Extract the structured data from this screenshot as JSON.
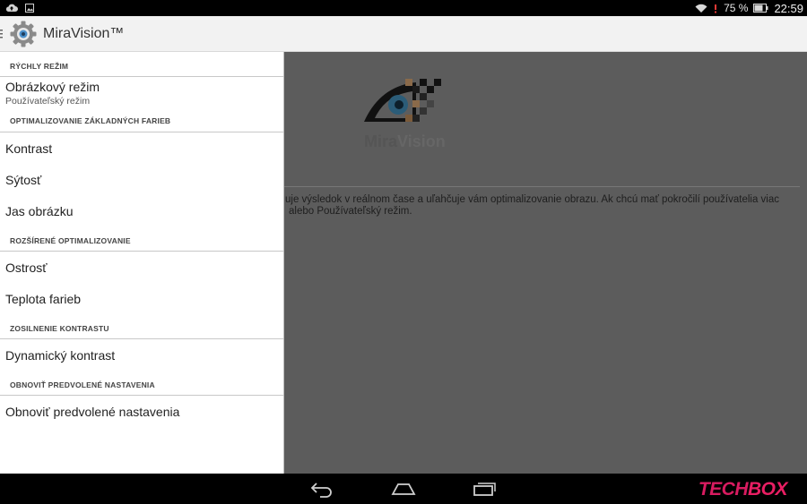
{
  "status_bar": {
    "battery_percent": "75 %",
    "clock": "22:59",
    "battery_level": 0.75
  },
  "action_bar": {
    "title": "MiraVision™"
  },
  "drawer": {
    "sections": [
      {
        "header": "RÝCHLY REŽIM",
        "items": [
          {
            "title": "Obrázkový režim",
            "subtitle": "Používateľský režim"
          }
        ]
      },
      {
        "header": "OPTIMALIZOVANIE ZÁKLADNÝCH FARIEB",
        "items": [
          {
            "title": "Kontrast"
          },
          {
            "title": "Sýtosť"
          },
          {
            "title": "Jas obrázku"
          }
        ]
      },
      {
        "header": "ROZŠÍRENÉ OPTIMALIZOVANIE",
        "items": [
          {
            "title": "Ostrosť"
          },
          {
            "title": "Teplota farieb"
          }
        ]
      },
      {
        "header": "ZOSILNENIE KONTRASTU",
        "items": [
          {
            "title": "Dynamický kontrast"
          }
        ]
      },
      {
        "header": "OBNOVIŤ PREDVOLENÉ NASTAVENIA",
        "items": [
          {
            "title": "Obnoviť predvolené nastavenia"
          }
        ]
      }
    ]
  },
  "content": {
    "logo_text_mira": "Mira",
    "logo_text_vision": "Vision",
    "description_line1": "uje výsledok v reálnom čase a uľahčuje vám optimalizovanie obrazu. Ak chcú mať pokročilí používatelia viac",
    "description_line2": "alebo Používateľský režim."
  },
  "watermark": {
    "tech": "TECH",
    "box": "BOX"
  }
}
